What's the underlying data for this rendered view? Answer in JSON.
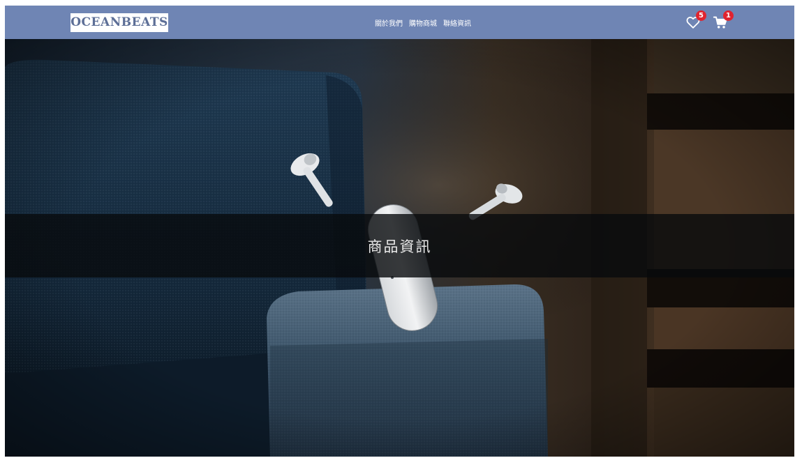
{
  "navbar": {
    "logo_text": "OCEANBEATS",
    "links": [
      "關於我們",
      "購物商城",
      "聯絡資訊"
    ],
    "wishlist": {
      "icon": "heart-icon",
      "count": "5"
    },
    "cart": {
      "icon": "cart-icon",
      "count": "1"
    }
  },
  "hero": {
    "title": "商品資訊",
    "image": "earbuds-floating-over-sofa-arm"
  },
  "colors": {
    "navbar_bg": "#6f85b4",
    "badge": "#e0242f",
    "banner_overlay": "rgba(8,10,12,0.8)"
  }
}
